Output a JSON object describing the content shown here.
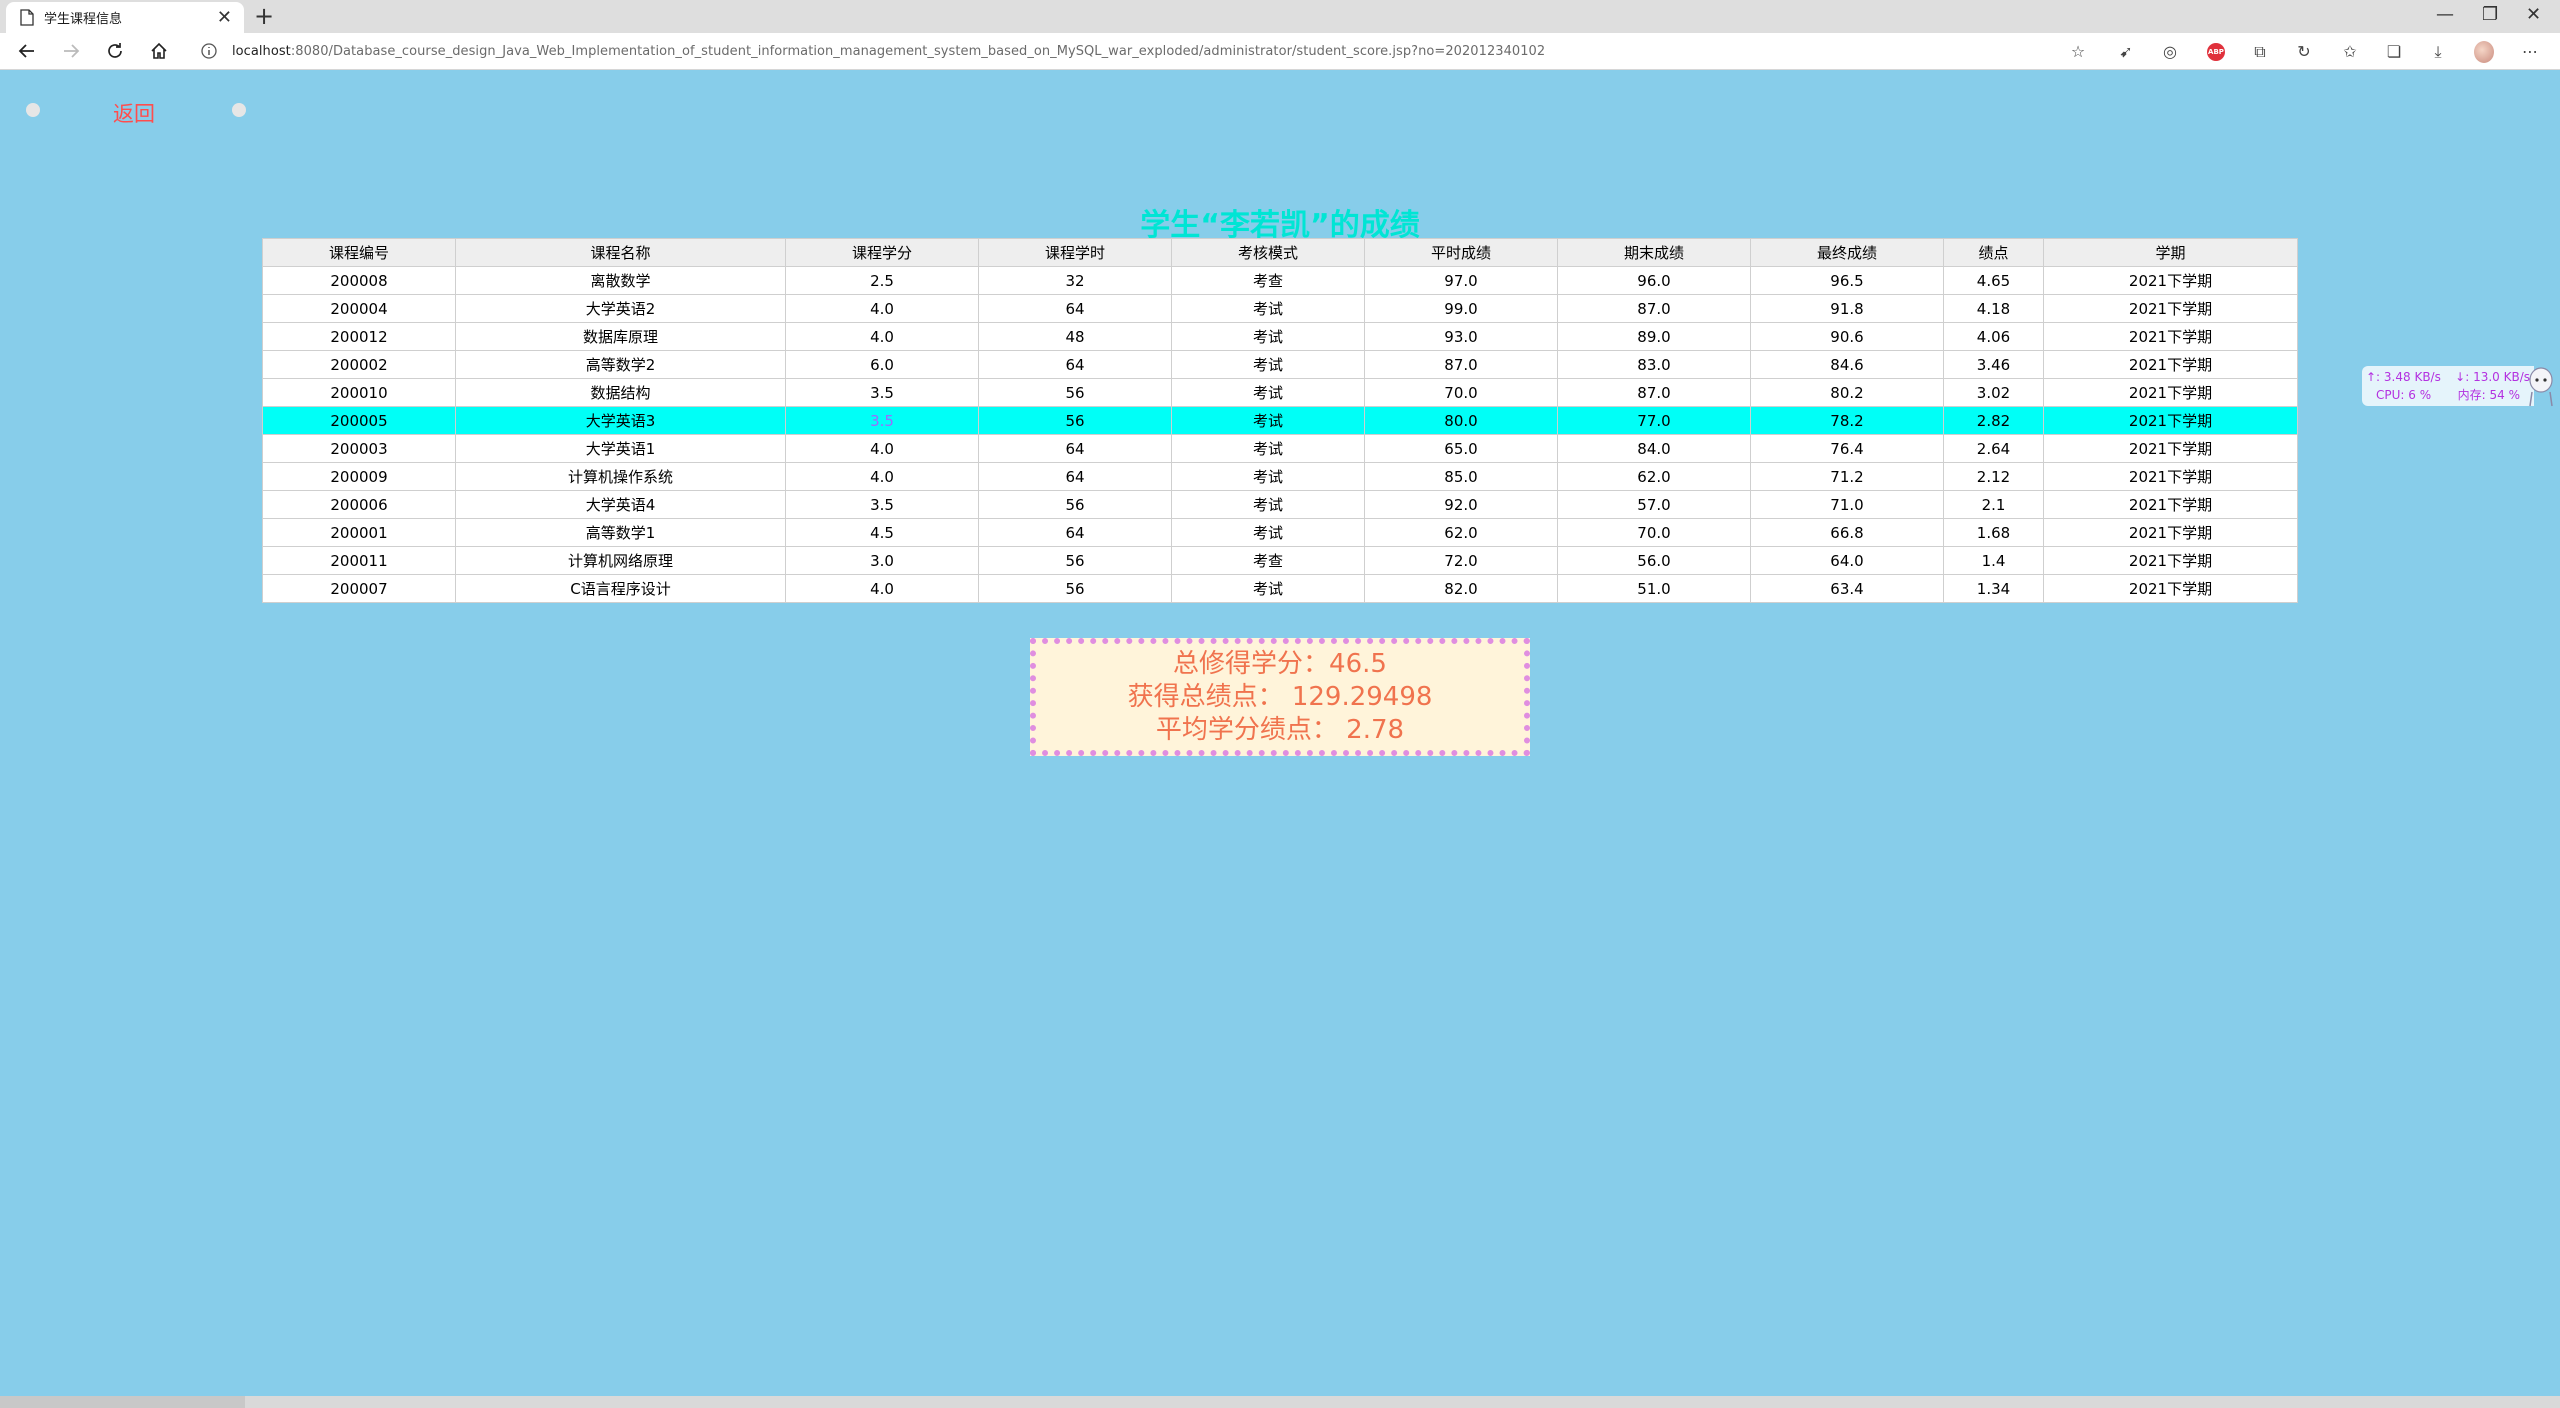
{
  "browser": {
    "tab_title": "学生课程信息",
    "tab_close": "✕",
    "new_tab": "+",
    "url_host": "localhost",
    "url_rest": ":8080/Database_course_design_Java_Web_Implementation_of_student_information_management_system_based_on_MySQL_war_exploded/administrator/student_score.jsp?no=202012340102",
    "window_controls": [
      "—",
      "❐",
      "✕"
    ],
    "icons": [
      "favorites-add-icon",
      "extension-icon",
      "extension-icon",
      "adblock-icon",
      "collections-icon",
      "refresh-extension-icon",
      "favorites-icon",
      "collections-icon",
      "downloads-icon",
      "profile-icon",
      "more-icon"
    ],
    "adblock_label": "ABP"
  },
  "page": {
    "back_label": "返回",
    "heading": "学生“李若凯”的成绩",
    "columns": [
      "课程编号",
      "课程名称",
      "课程学分",
      "课程学时",
      "考核模式",
      "平时成绩",
      "期末成绩",
      "最终成绩",
      "绩点",
      "学期"
    ],
    "rows": [
      [
        "200008",
        "离散数学",
        "2.5",
        "32",
        "考查",
        "97.0",
        "96.0",
        "96.5",
        "4.65",
        "2021下学期"
      ],
      [
        "200004",
        "大学英语2",
        "4.0",
        "64",
        "考试",
        "99.0",
        "87.0",
        "91.8",
        "4.18",
        "2021下学期"
      ],
      [
        "200012",
        "数据库原理",
        "4.0",
        "48",
        "考试",
        "93.0",
        "89.0",
        "90.6",
        "4.06",
        "2021下学期"
      ],
      [
        "200002",
        "高等数学2",
        "6.0",
        "64",
        "考试",
        "87.0",
        "83.0",
        "84.6",
        "3.46",
        "2021下学期"
      ],
      [
        "200010",
        "数据结构",
        "3.5",
        "56",
        "考试",
        "70.0",
        "87.0",
        "80.2",
        "3.02",
        "2021下学期"
      ],
      [
        "200005",
        "大学英语3",
        "3.5",
        "56",
        "考试",
        "80.0",
        "77.0",
        "78.2",
        "2.82",
        "2021下学期"
      ],
      [
        "200003",
        "大学英语1",
        "4.0",
        "64",
        "考试",
        "65.0",
        "84.0",
        "76.4",
        "2.64",
        "2021下学期"
      ],
      [
        "200009",
        "计算机操作系统",
        "4.0",
        "64",
        "考试",
        "85.0",
        "62.0",
        "71.2",
        "2.12",
        "2021下学期"
      ],
      [
        "200006",
        "大学英语4",
        "3.5",
        "56",
        "考试",
        "92.0",
        "57.0",
        "71.0",
        "2.1",
        "2021下学期"
      ],
      [
        "200001",
        "高等数学1",
        "4.5",
        "64",
        "考试",
        "62.0",
        "70.0",
        "66.8",
        "1.68",
        "2021下学期"
      ],
      [
        "200011",
        "计算机网络原理",
        "3.0",
        "56",
        "考查",
        "72.0",
        "56.0",
        "64.0",
        "1.4",
        "2021下学期"
      ],
      [
        "200007",
        "C语言程序设计",
        "4.0",
        "56",
        "考试",
        "82.0",
        "51.0",
        "63.4",
        "1.34",
        "2021下学期"
      ]
    ],
    "highlight_row_index": 5,
    "highlight_color": "#00fff7",
    "summary": {
      "total_credits": "总修得学分：46.5",
      "total_gpa": "获得总绩点： 129.29498",
      "avg_gpa": "平均学分绩点： 2.78"
    }
  },
  "net_monitor": {
    "upload": "↑: 3.48 KB/s",
    "download": "↓: 13.0 KB/s",
    "cpu": "CPU: 6 %",
    "memory": "内存: 54 %"
  },
  "colors": {
    "page_bg": "#87cdea",
    "heading": "#00e5d4",
    "back_link": "#ff4d4d",
    "summary_text": "#f0734e",
    "summary_bg": "#fff4da",
    "summary_border": "#e08ee0"
  }
}
